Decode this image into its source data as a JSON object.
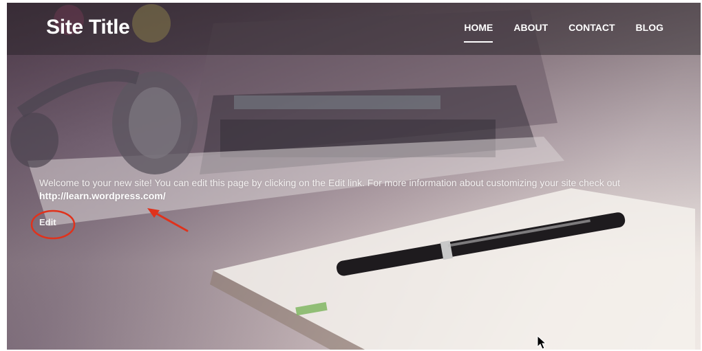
{
  "header": {
    "site_title": "Site Title",
    "nav": [
      {
        "label": "HOME",
        "active": true
      },
      {
        "label": "ABOUT",
        "active": false
      },
      {
        "label": "CONTACT",
        "active": false
      },
      {
        "label": "BLOG",
        "active": false
      }
    ]
  },
  "content": {
    "intro": "Welcome to your new site! You can edit this page by clicking on the Edit link. For more information about customizing your site check out",
    "link": "http://learn.wordpress.com/",
    "edit_label": "Edit"
  },
  "annotations": {
    "color": "#e0321c",
    "items": [
      "arrow-to-link",
      "circle-around-edit"
    ]
  },
  "cursor": {
    "icon": "mouse-pointer-icon"
  }
}
